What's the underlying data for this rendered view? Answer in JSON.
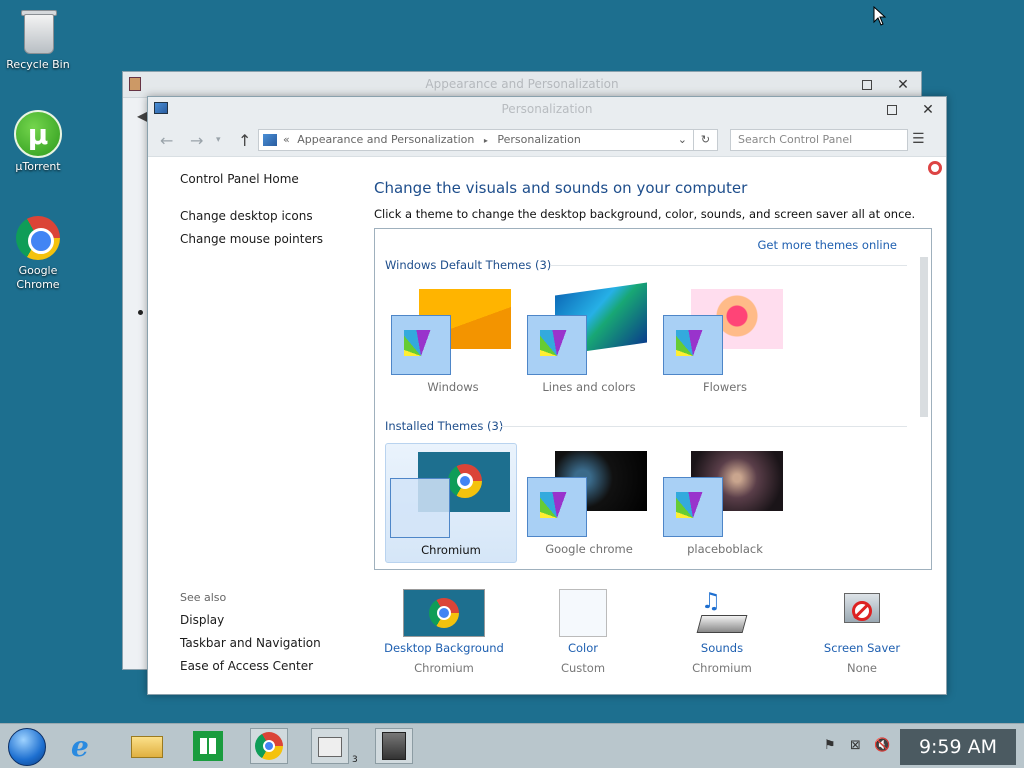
{
  "desktop": {
    "icons": [
      {
        "label": "Recycle Bin"
      },
      {
        "label": "µTorrent"
      },
      {
        "label": "Google Chrome"
      }
    ]
  },
  "back_window": {
    "title": "Appearance and Personalization"
  },
  "window": {
    "title": "Personalization",
    "breadcrumb_prefix": "«",
    "breadcrumb": [
      "Appearance and Personalization",
      "Personalization"
    ],
    "search_placeholder": "Search Control Panel",
    "sidebar": {
      "home": "Control Panel Home",
      "links": [
        "Change desktop icons",
        "Change mouse pointers"
      ]
    },
    "see_also": {
      "heading": "See also",
      "links": [
        "Display",
        "Taskbar and Navigation",
        "Ease of Access Center"
      ]
    },
    "heading": "Change the visuals and sounds on your computer",
    "subheading": "Click a theme to change the desktop background, color, sounds, and screen saver all at once.",
    "get_more_themes": "Get more themes online",
    "groups": [
      {
        "title": "Windows Default Themes (3)",
        "themes": [
          "Windows",
          "Lines and colors",
          "Flowers"
        ]
      },
      {
        "title": "Installed Themes (3)",
        "themes": [
          "Chromium",
          "Google chrome",
          "placeboblack"
        ],
        "selected": "Chromium"
      }
    ],
    "bottom": [
      {
        "title": "Desktop Background",
        "value": "Chromium"
      },
      {
        "title": "Color",
        "value": "Custom"
      },
      {
        "title": "Sounds",
        "value": "Chromium"
      },
      {
        "title": "Screen Saver",
        "value": "None"
      }
    ]
  },
  "taskbar": {
    "clock": "9:59 AM",
    "badge": "3",
    "apps": [
      "start-button",
      "internet-explorer-icon",
      "file-explorer-icon",
      "store-icon",
      "chrome-icon",
      "control-panel-icon",
      "tablet-icon"
    ]
  },
  "colors": {
    "desktop": "#1d6f8f",
    "link": "#1e5fb0",
    "heading": "#1e4e8c"
  }
}
